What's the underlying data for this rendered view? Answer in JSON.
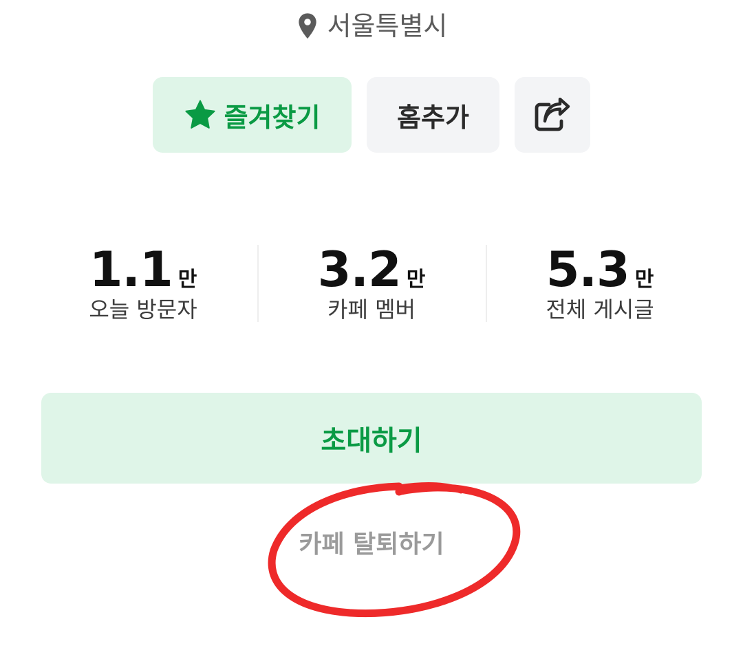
{
  "location": {
    "icon": "map-pin-icon",
    "text": "서울특별시"
  },
  "actions": {
    "favorite": {
      "icon": "star-icon",
      "label": "즐겨찾기"
    },
    "home_add": {
      "label": "홈추가"
    },
    "share": {
      "icon": "share-icon"
    }
  },
  "stats": [
    {
      "number": "1.1",
      "unit": "만",
      "label": "오늘 방문자"
    },
    {
      "number": "3.2",
      "unit": "만",
      "label": "카페 멤버"
    },
    {
      "number": "5.3",
      "unit": "만",
      "label": "전체 게시글"
    }
  ],
  "invite": {
    "label": "초대하기"
  },
  "leave": {
    "label": "카페 탈퇴하기"
  },
  "colors": {
    "accent_green": "#0a9a44",
    "accent_bg": "#dff5e8",
    "neutral_bg": "#f3f4f6",
    "annotation_red": "#ee2a2a"
  }
}
